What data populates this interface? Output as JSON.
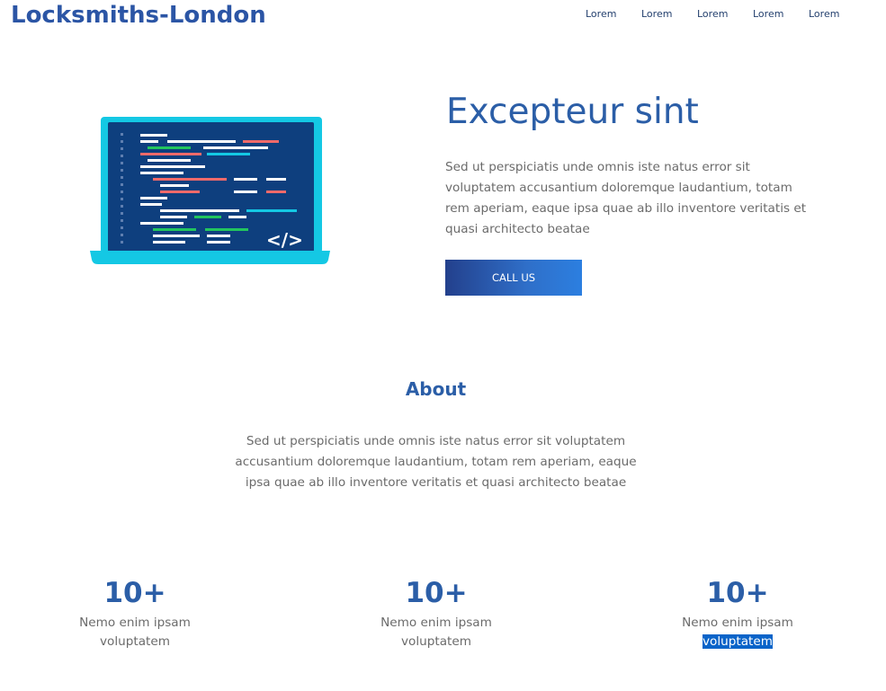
{
  "header": {
    "brand": "Locksmiths-London",
    "nav": [
      "Lorem",
      "Lorem",
      "Lorem",
      "Lorem",
      "Lorem"
    ]
  },
  "hero": {
    "title": "Excepteur sint",
    "text": "Sed ut perspiciatis unde omnis iste natus error sit voluptatem accusantium doloremque laudantium, totam rem aperiam, eaque ipsa quae ab illo inventore veritatis et quasi architecto beatae",
    "button_label": "CALL US",
    "illustration_code_glyph": "</>"
  },
  "about": {
    "title": "About",
    "text": "Sed ut perspiciatis unde omnis iste natus error sit voluptatem accusantium doloremque laudantium, totam rem aperiam, eaque ipsa quae ab illo inventore veritatis et quasi architecto beatae"
  },
  "stats": [
    {
      "value": "10+",
      "line1": "Nemo enim ipsam",
      "line2": "voluptatem"
    },
    {
      "value": "10+",
      "line1": "Nemo enim ipsam",
      "line2": "voluptatem"
    },
    {
      "value": "10+",
      "line1": "Nemo enim ipsam",
      "line2": "voluptatem",
      "line2_selected": true
    }
  ],
  "colors": {
    "brand": "#2b55a5",
    "heading": "#2b5ea7",
    "body_text": "#6b6b6b",
    "button_gradient_start": "#23408c",
    "button_gradient_end": "#2c7fe0",
    "selection": "#0a64c9"
  }
}
